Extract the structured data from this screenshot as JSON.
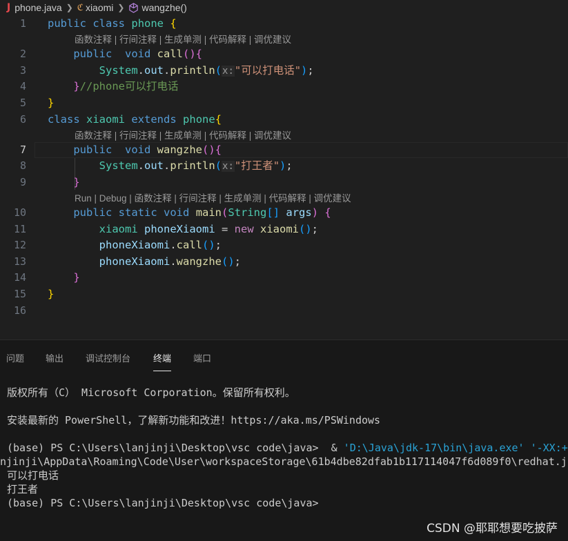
{
  "breadcrumb": {
    "file": "phone.java",
    "class": "xiaomi",
    "method": "wangzhe()",
    "file_icon": "J"
  },
  "codelens": {
    "actions": "函数注释 | 行间注释 | 生成单测 | 代码解释 | 调优建议",
    "main_actions": "Run | Debug | 函数注释 | 行间注释 | 生成单测 | 代码解释 | 调优建议"
  },
  "editor": {
    "line_numbers": [
      "1",
      "2",
      "3",
      "4",
      "5",
      "6",
      "7",
      "8",
      "9",
      "10",
      "11",
      "12",
      "13",
      "14",
      "15",
      "16"
    ],
    "tokens": {
      "public": "public",
      "class": "class",
      "void": "void",
      "static": "static",
      "extends": "extends",
      "new": "new",
      "phone": "phone",
      "xiaomi": "xiaomi",
      "call": "call",
      "wangzhe": "wangzhe",
      "main": "main",
      "System": "System",
      "out": "out",
      "println": "println",
      "hint_x": "x:",
      "str_call": "\"可以打电话\"",
      "str_wangzhe": "\"打王者\"",
      "comment_phone": "//phone可以打电话",
      "String": "String",
      "args": "args",
      "phoneXiaomi": "phoneXiaomi"
    }
  },
  "panel": {
    "tabs": [
      "问题",
      "输出",
      "调试控制台",
      "终端",
      "端口"
    ],
    "active_tab": "终端"
  },
  "terminal": {
    "lines": [
      "版权所有（C） Microsoft Corporation。保留所有权利。",
      "安装最新的 PowerShell，了解新功能和改进！https://aka.ms/PSWindows",
      "(base) PS C:\\Users\\lanjinji\\Desktop\\vsc code\\java>  & ",
      "'D:\\Java\\jdk-17\\bin\\java.exe' '-XX:+S",
      "njinji\\AppData\\Roaming\\Code\\User\\workspaceStorage\\61b4dbe82dfab1b117114047f6d089f0\\redhat.j",
      "可以打电话",
      "打王者",
      "(base) PS C:\\Users\\lanjinji\\Desktop\\vsc code\\java>"
    ]
  },
  "watermark": "CSDN @耶耶想要吃披萨",
  "colors": {
    "background": "#1f1f1f",
    "panel": "#181818",
    "keyword": "#569cd6",
    "type": "#4ec9b0",
    "function": "#dcdcaa",
    "string": "#ce9178",
    "comment": "#6a9955"
  }
}
